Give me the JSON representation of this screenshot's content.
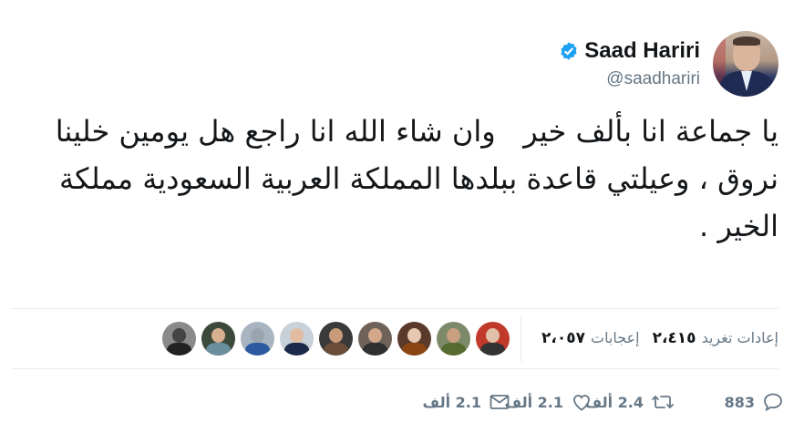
{
  "author": {
    "display_name": "Saad Hariri",
    "handle": "@saadhariri",
    "verified_icon": "verified-badge-icon",
    "verified_color": "#1da1f2"
  },
  "tweet": {
    "text": "يا جماعة انا بألف خير   وان شاء الله انا راجع هل يومين خلينا نروق ، وعيلتي قاعدة ببلدها المملكة العربية السعودية مملكة الخير ."
  },
  "stats": {
    "retweets_count": "٢،٤١٥",
    "retweets_label": "إعادات تغريد",
    "likes_count": "٢،٠٥٧",
    "likes_label": "إعجابات"
  },
  "likers": [
    {
      "name": "liker-1",
      "head": "#e0c0a8",
      "body": "#333333",
      "bg": "#c0392b"
    },
    {
      "name": "liker-2",
      "head": "#c8a080",
      "body": "#556b2f",
      "bg": "#7d8a6a"
    },
    {
      "name": "liker-3",
      "head": "#e6c8b0",
      "body": "#8b4513",
      "bg": "#5a3a2a"
    },
    {
      "name": "liker-4",
      "head": "#d2a78a",
      "body": "#2f2f2f",
      "bg": "#6e6259"
    },
    {
      "name": "liker-5",
      "head": "#c89a78",
      "body": "#6b4e3a",
      "bg": "#3a3a3a"
    },
    {
      "name": "liker-6",
      "head": "#e2bca0",
      "body": "#1c2a4a",
      "bg": "#c8d0d8"
    },
    {
      "name": "liker-7",
      "head": "#9aa4ae",
      "body": "#2b5aa0",
      "bg": "#a8b4c0"
    },
    {
      "name": "liker-8",
      "head": "#d8b090",
      "body": "#6b8e9e",
      "bg": "#3b4a3a"
    },
    {
      "name": "liker-9",
      "head": "#444444",
      "body": "#222222",
      "bg": "#8a8a8a"
    }
  ],
  "actions": {
    "reply_count": "883",
    "retweet_count": "2.4 ألف",
    "like_count": "2.1 ألف",
    "reply_icon": "reply-icon",
    "retweet_icon": "retweet-icon",
    "like_icon": "heart-icon",
    "dm_icon": "envelope-icon"
  }
}
